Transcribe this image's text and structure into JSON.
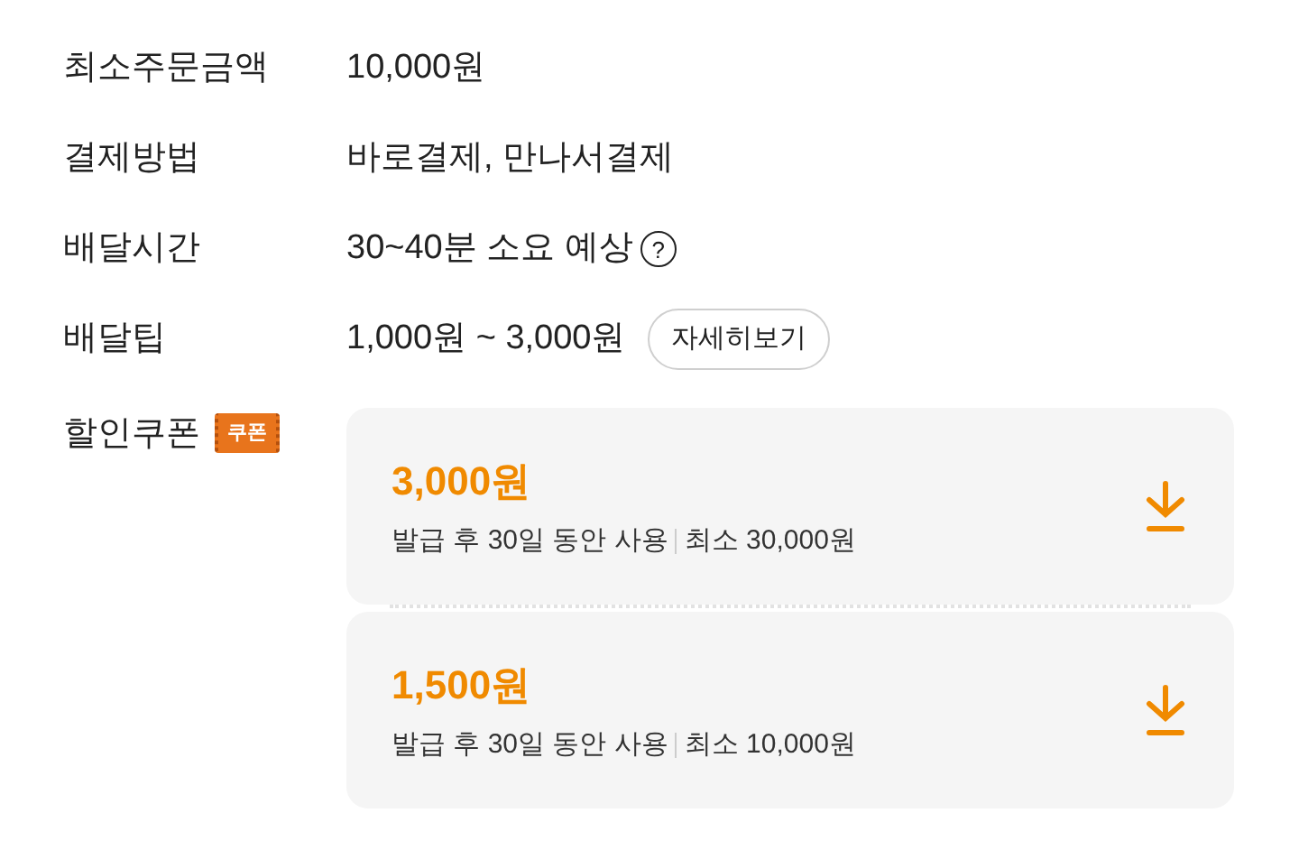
{
  "info_rows": [
    {
      "label": "최소주문금액",
      "value": "10,000원",
      "kind": "text"
    },
    {
      "label": "결제방법",
      "value": "바로결제, 만나서결제",
      "kind": "text"
    },
    {
      "label": "배달시간",
      "value": "30~40분 소요 예상",
      "kind": "help",
      "help": "?"
    },
    {
      "label": "배달팁",
      "value": "1,000원 ~ 3,000원",
      "kind": "button",
      "button": "자세히보기"
    }
  ],
  "coupons": {
    "label": "할인쿠폰",
    "badge": "쿠폰",
    "items": [
      {
        "amount": "3,000원",
        "period": "발급 후 30일 동안 사용",
        "minimum": "최소 30,000원"
      },
      {
        "amount": "1,500원",
        "period": "발급 후 30일 동안 사용",
        "minimum": "최소 10,000원"
      }
    ]
  }
}
